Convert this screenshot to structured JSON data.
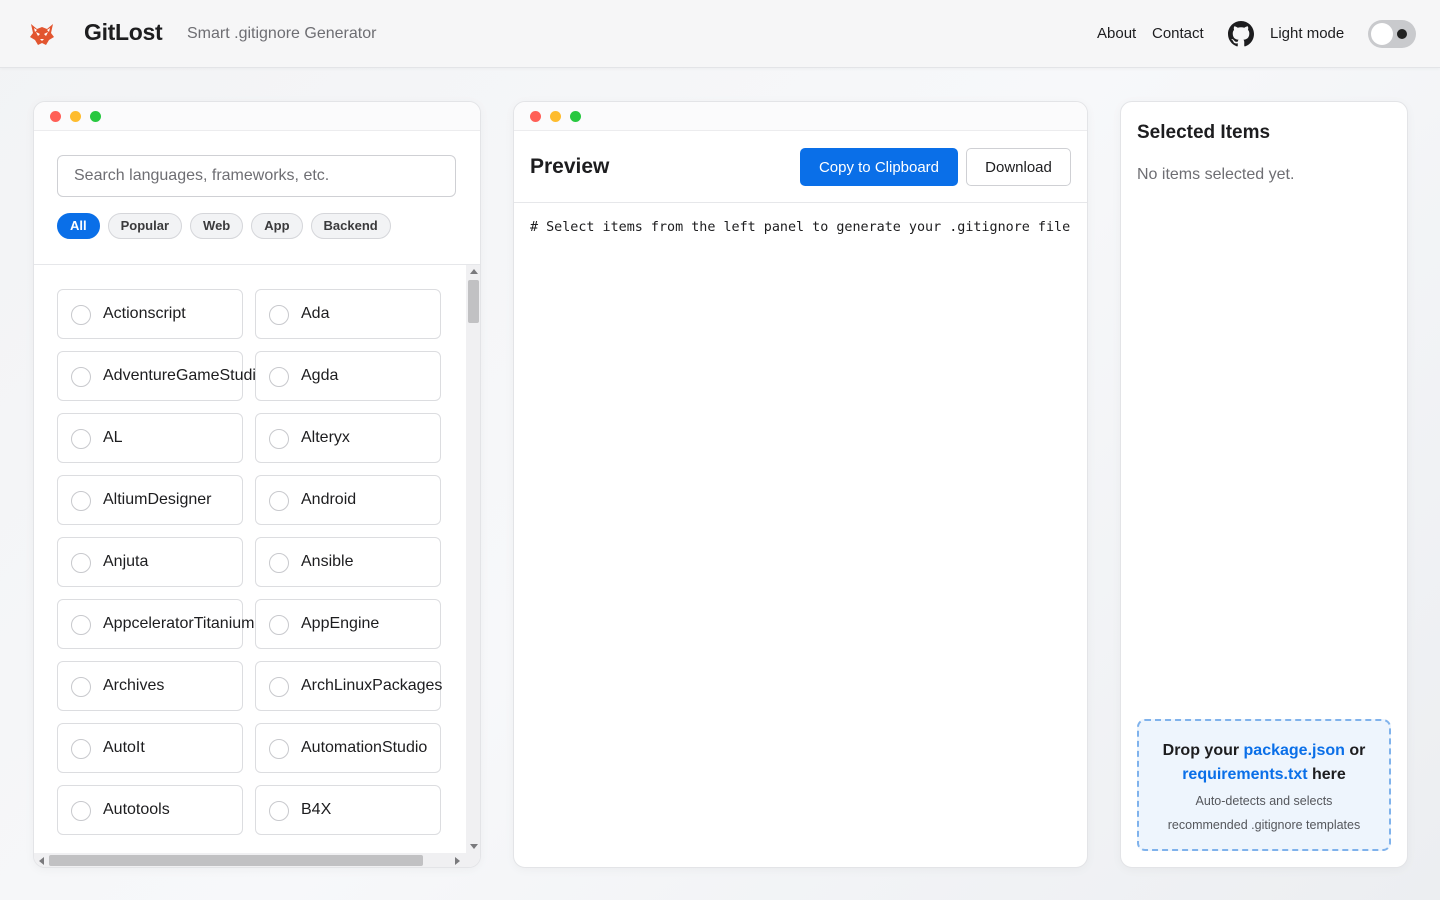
{
  "header": {
    "brand": "GitLost",
    "tagline": "Smart .gitignore Generator",
    "nav": {
      "about": "About",
      "contact": "Contact"
    },
    "mode_label": "Light mode"
  },
  "left": {
    "search_placeholder": "Search languages, frameworks, etc.",
    "filters": [
      "All",
      "Popular",
      "Web",
      "App",
      "Backend"
    ],
    "active_filter": "All",
    "items": [
      "Actionscript",
      "Ada",
      "AdventureGameStudio",
      "Agda",
      "AL",
      "Alteryx",
      "AltiumDesigner",
      "Android",
      "Anjuta",
      "Ansible",
      "AppceleratorTitanium",
      "AppEngine",
      "Archives",
      "ArchLinuxPackages",
      "AutoIt",
      "AutomationStudio",
      "Autotools",
      "B4X"
    ]
  },
  "preview": {
    "title": "Preview",
    "copy_label": "Copy to Clipboard",
    "download_label": "Download",
    "code": "# Select items from the left panel to generate your .gitignore file"
  },
  "selected": {
    "title": "Selected Items",
    "empty_text": "No items selected yet.",
    "drop_prefix": "Drop your ",
    "drop_file1": "package.json",
    "drop_or": " or ",
    "drop_file2": "requirements.txt",
    "drop_suffix": " here",
    "drop_sub1": "Auto-detects and selects",
    "drop_sub2": "recommended .gitignore templates"
  },
  "colors": {
    "accent": "#0a6fe8",
    "logo": "#e2552f"
  }
}
